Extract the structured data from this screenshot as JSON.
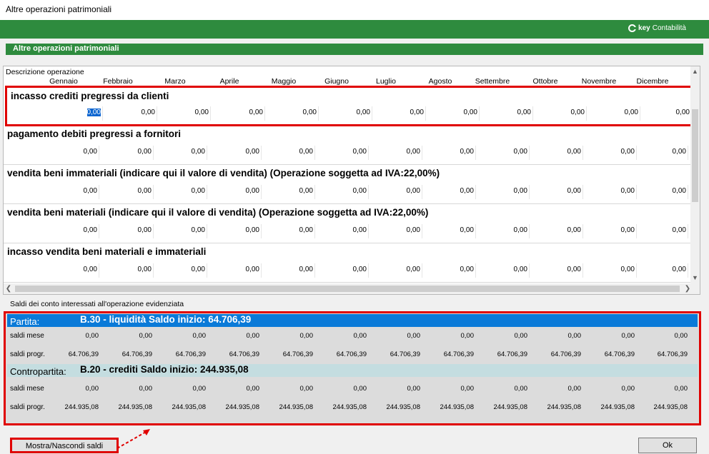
{
  "window": {
    "title": "Altre operazioni patrimoniali"
  },
  "brand": {
    "part1": "key",
    "part2": "Contabilità"
  },
  "section": {
    "title": "Altre operazioni patrimoniali"
  },
  "grid": {
    "description_header": "Descrizione operazione",
    "months": [
      "Gennaio",
      "Febbraio",
      "Marzo",
      "Aprile",
      "Maggio",
      "Giugno",
      "Luglio",
      "Agosto",
      "Settembre",
      "Ottobre",
      "Novembre",
      "Dicembre"
    ],
    "operations": [
      {
        "title": "incasso crediti pregressi da clienti",
        "values": [
          "0,00",
          "0,00",
          "0,00",
          "0,00",
          "0,00",
          "0,00",
          "0,00",
          "0,00",
          "0,00",
          "0,00",
          "0,00",
          "0,00"
        ]
      },
      {
        "title": "pagamento debiti pregressi a fornitori",
        "values": [
          "0,00",
          "0,00",
          "0,00",
          "0,00",
          "0,00",
          "0,00",
          "0,00",
          "0,00",
          "0,00",
          "0,00",
          "0,00",
          "0,00"
        ]
      },
      {
        "title": "vendita beni immateriali (indicare qui il valore di vendita)  (Operazione soggetta ad IVA:22,00%)",
        "values": [
          "0,00",
          "0,00",
          "0,00",
          "0,00",
          "0,00",
          "0,00",
          "0,00",
          "0,00",
          "0,00",
          "0,00",
          "0,00",
          "0,00"
        ]
      },
      {
        "title": "vendita beni materiali (indicare qui il valore di vendita)  (Operazione soggetta ad IVA:22,00%)",
        "values": [
          "0,00",
          "0,00",
          "0,00",
          "0,00",
          "0,00",
          "0,00",
          "0,00",
          "0,00",
          "0,00",
          "0,00",
          "0,00",
          "0,00"
        ]
      },
      {
        "title": "incasso vendita beni materiali e immateriali",
        "values": [
          "0,00",
          "0,00",
          "0,00",
          "0,00",
          "0,00",
          "0,00",
          "0,00",
          "0,00",
          "0,00",
          "0,00",
          "0,00",
          "0,00"
        ]
      }
    ]
  },
  "saldi": {
    "caption": "Saldi dei conto interessati all'operazione evidenziata",
    "partita": {
      "label": "Partita:",
      "account": "B.30 - liquidità   Saldo inizio: 64.706,39",
      "saldi_mese_label": "saldi mese",
      "saldi_mese": [
        "0,00",
        "0,00",
        "0,00",
        "0,00",
        "0,00",
        "0,00",
        "0,00",
        "0,00",
        "0,00",
        "0,00",
        "0,00",
        "0,00"
      ],
      "saldi_progr_label": "saldi progr.",
      "saldi_progr": [
        "64.706,39",
        "64.706,39",
        "64.706,39",
        "64.706,39",
        "64.706,39",
        "64.706,39",
        "64.706,39",
        "64.706,39",
        "64.706,39",
        "64.706,39",
        "64.706,39",
        "64.706,39"
      ]
    },
    "contropartita": {
      "label": "Contropartita:",
      "account": "B.20 - crediti   Saldo inizio: 244.935,08",
      "saldi_mese_label": "saldi mese",
      "saldi_mese": [
        "0,00",
        "0,00",
        "0,00",
        "0,00",
        "0,00",
        "0,00",
        "0,00",
        "0,00",
        "0,00",
        "0,00",
        "0,00",
        "0,00"
      ],
      "saldi_progr_label": "saldi progr.",
      "saldi_progr": [
        "244.935,08",
        "244.935,08",
        "244.935,08",
        "244.935,08",
        "244.935,08",
        "244.935,08",
        "244.935,08",
        "244.935,08",
        "244.935,08",
        "244.935,08",
        "244.935,08",
        "244.935,08"
      ]
    }
  },
  "buttons": {
    "toggle": "Mostra/Nascondi saldi",
    "ok": "Ok"
  }
}
